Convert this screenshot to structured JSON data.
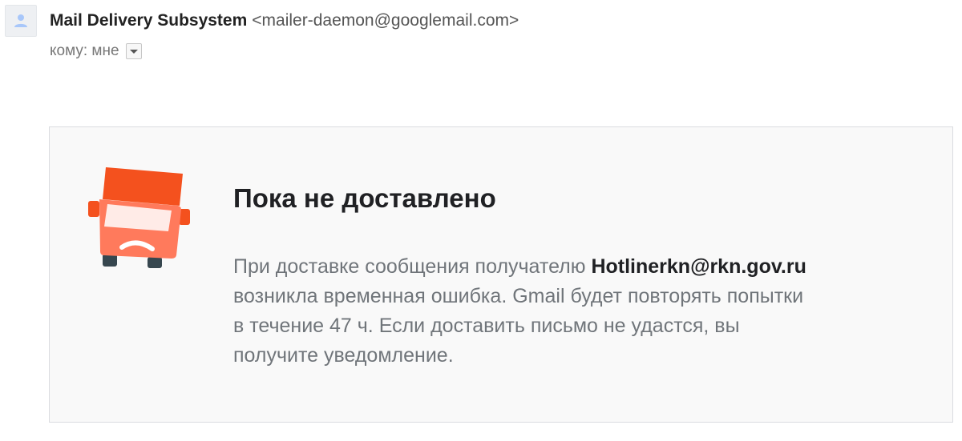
{
  "header": {
    "sender_name": "Mail Delivery Subsystem",
    "sender_email": "<mailer-daemon@googlemail.com>",
    "recipient_label": "кому: мне"
  },
  "notice": {
    "title": "Пока не доставлено",
    "line1_prefix": "При доставке сообщения получателю",
    "recipient_email": "Hotlinerkn@rkn.gov.ru",
    "line2": "возникла временная ошибка. Gmail будет повторять попытки",
    "line3": "в течение 47 ч. Если доставить письмо не удастся, вы",
    "line4": "получите уведомление."
  },
  "icons": {
    "avatar": "person-icon",
    "dropdown": "chevron-down-icon",
    "illustration": "sad-truck-icon"
  },
  "colors": {
    "truck_orange": "#f4511e",
    "truck_body": "#ff7a5c",
    "card_background": "#f9f9f9",
    "body_text": "#70757a"
  }
}
